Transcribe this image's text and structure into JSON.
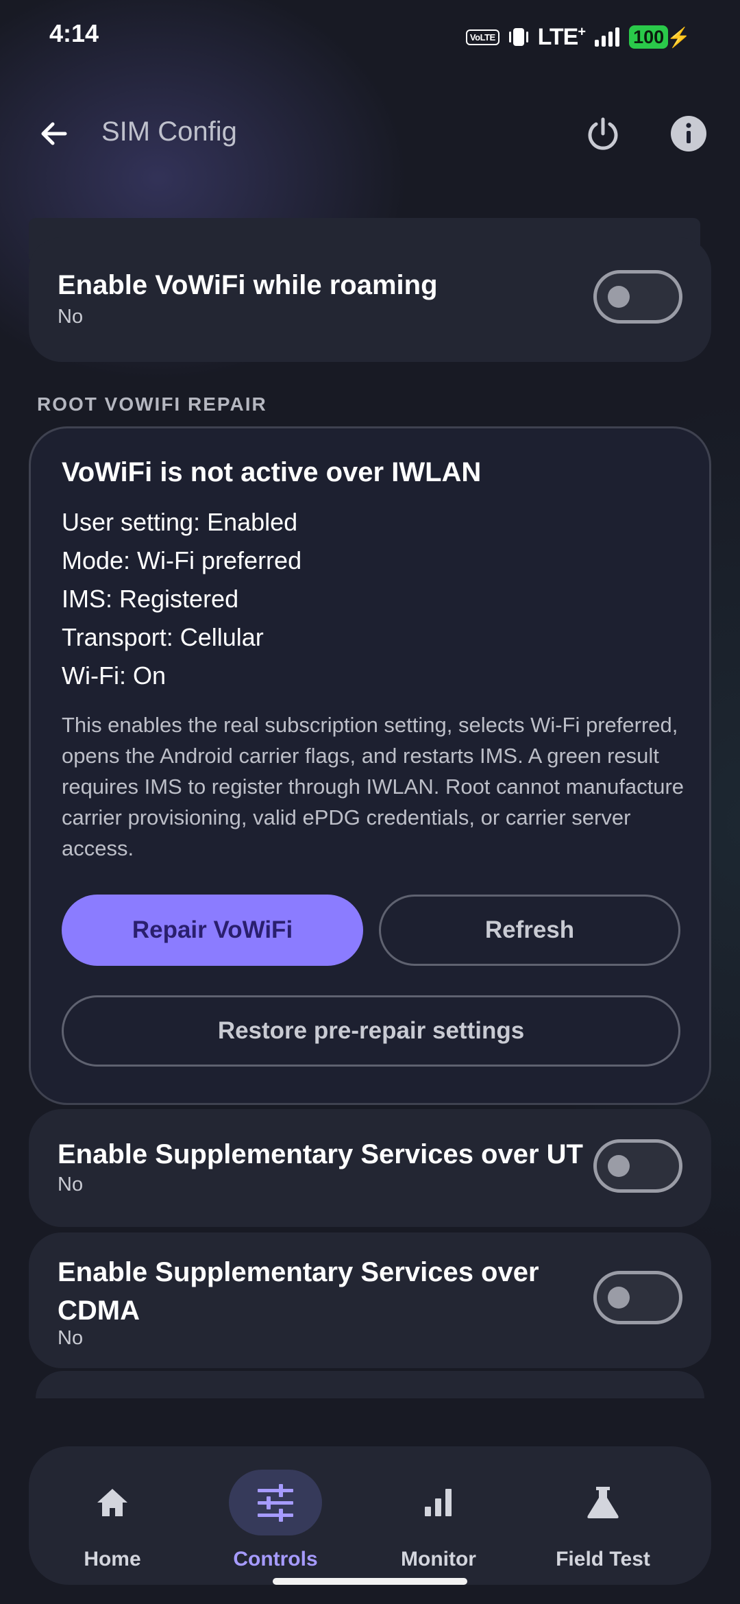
{
  "status_bar": {
    "time": "4:14",
    "volte": "VoLTE",
    "network": "LTE",
    "network_plus": "+",
    "battery": "100"
  },
  "app_bar": {
    "title": "SIM Config"
  },
  "settings": {
    "roaming": {
      "title": "Enable VoWiFi while roaming",
      "value": "No",
      "enabled": false
    },
    "ut": {
      "title": "Enable Supplementary Services over UT",
      "value": "No",
      "enabled": false
    },
    "cdma": {
      "title": "Enable Supplementary Services over CDMA",
      "value": "No",
      "enabled": false
    }
  },
  "repair": {
    "section_label": "ROOT VOWIFI REPAIR",
    "title": "VoWiFi is not active over IWLAN",
    "status_lines": [
      "User setting: Enabled",
      "Mode: Wi-Fi preferred",
      "IMS: Registered",
      "Transport: Cellular",
      "Wi-Fi: On"
    ],
    "description": "This enables the real subscription setting, selects Wi-Fi preferred, opens the Android carrier flags, and restarts IMS. A green result requires IMS to register through IWLAN. Root cannot manufacture carrier provisioning, valid ePDG credentials, or carrier server access.",
    "repair_button": "Repair VoWiFi",
    "refresh_button": "Refresh",
    "restore_button": "Restore pre-repair settings"
  },
  "nav": {
    "items": [
      {
        "label": "Home",
        "icon": "home-icon"
      },
      {
        "label": "Controls",
        "icon": "sliders-icon"
      },
      {
        "label": "Monitor",
        "icon": "bar-chart-icon"
      },
      {
        "label": "Field Test",
        "icon": "flask-icon"
      }
    ],
    "active": "Controls"
  },
  "colors": {
    "background": "#181a24",
    "card": "#232633",
    "accent": "#8b7cff",
    "accent_text": "#2a1f6e",
    "battery": "#2ac94a"
  }
}
